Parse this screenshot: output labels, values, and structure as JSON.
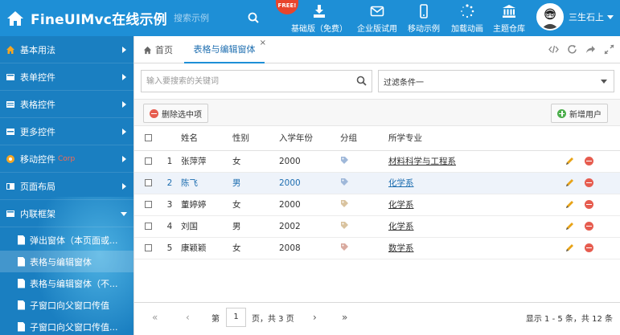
{
  "header": {
    "title": "FineUIMvc在线示例",
    "search_placeholder": "搜索示例",
    "free_badge": "FREE!",
    "nav": [
      {
        "label": "基础版（免费）",
        "icon": "download-icon"
      },
      {
        "label": "企业版试用",
        "icon": "envelope-icon"
      },
      {
        "label": "移动示例",
        "icon": "mobile-icon"
      },
      {
        "label": "加载动画",
        "icon": "spinner-icon"
      },
      {
        "label": "主题仓库",
        "icon": "bank-icon"
      }
    ],
    "user_name": "三生石上"
  },
  "sidebar": {
    "items": [
      {
        "label": "基本用法",
        "icon": "home-icon"
      },
      {
        "label": "表单控件",
        "icon": "form-icon"
      },
      {
        "label": "表格控件",
        "icon": "table-icon"
      },
      {
        "label": "更多控件",
        "icon": "list-icon"
      },
      {
        "label": "移动控件",
        "badge": "Corp",
        "icon": "mobile-icon"
      },
      {
        "label": "页面布局",
        "icon": "layout-icon"
      },
      {
        "label": "内联框架",
        "icon": "frame-icon"
      }
    ],
    "subitems": [
      "弹出窗体（本页面或...",
      "表格与编辑窗体",
      "表格与编辑窗体（不...",
      "子窗口向父窗口传值",
      "子窗口向父窗口传值..."
    ]
  },
  "tabs": {
    "home": "首页",
    "active": "表格与编辑窗体",
    "close": "×"
  },
  "search": {
    "placeholder": "输入要搜索的关键词"
  },
  "filter": {
    "value": "过滤条件一"
  },
  "toolbar": {
    "delete_label": "删除选中项",
    "add_label": "新增用户"
  },
  "grid": {
    "headers": [
      "姓名",
      "性别",
      "入学年份",
      "分组",
      "所学专业"
    ],
    "rows": [
      {
        "no": "1",
        "name": "张萍萍",
        "gender": "女",
        "year": "2000",
        "major": "材料科学与工程系"
      },
      {
        "no": "2",
        "name": "陈飞",
        "gender": "男",
        "year": "2000",
        "major": "化学系"
      },
      {
        "no": "3",
        "name": "董婷婷",
        "gender": "女",
        "year": "2000",
        "major": "化学系"
      },
      {
        "no": "4",
        "name": "刘国",
        "gender": "男",
        "year": "2002",
        "major": "化学系"
      },
      {
        "no": "5",
        "name": "康颖颖",
        "gender": "女",
        "year": "2008",
        "major": "数学系"
      }
    ]
  },
  "pager": {
    "first": "«",
    "prev": "‹",
    "page_prefix": "第",
    "page": "1",
    "page_suffix": "页，共 3 页",
    "next": "›",
    "last": "»",
    "info": "显示 1 - 5 条，共 12 条"
  },
  "colors": {
    "header_bg": "#1e8fd6",
    "sidebar_bg": "#1a7fc1",
    "selected_row": "#eef3fa",
    "accent": "#1e6eb0"
  }
}
